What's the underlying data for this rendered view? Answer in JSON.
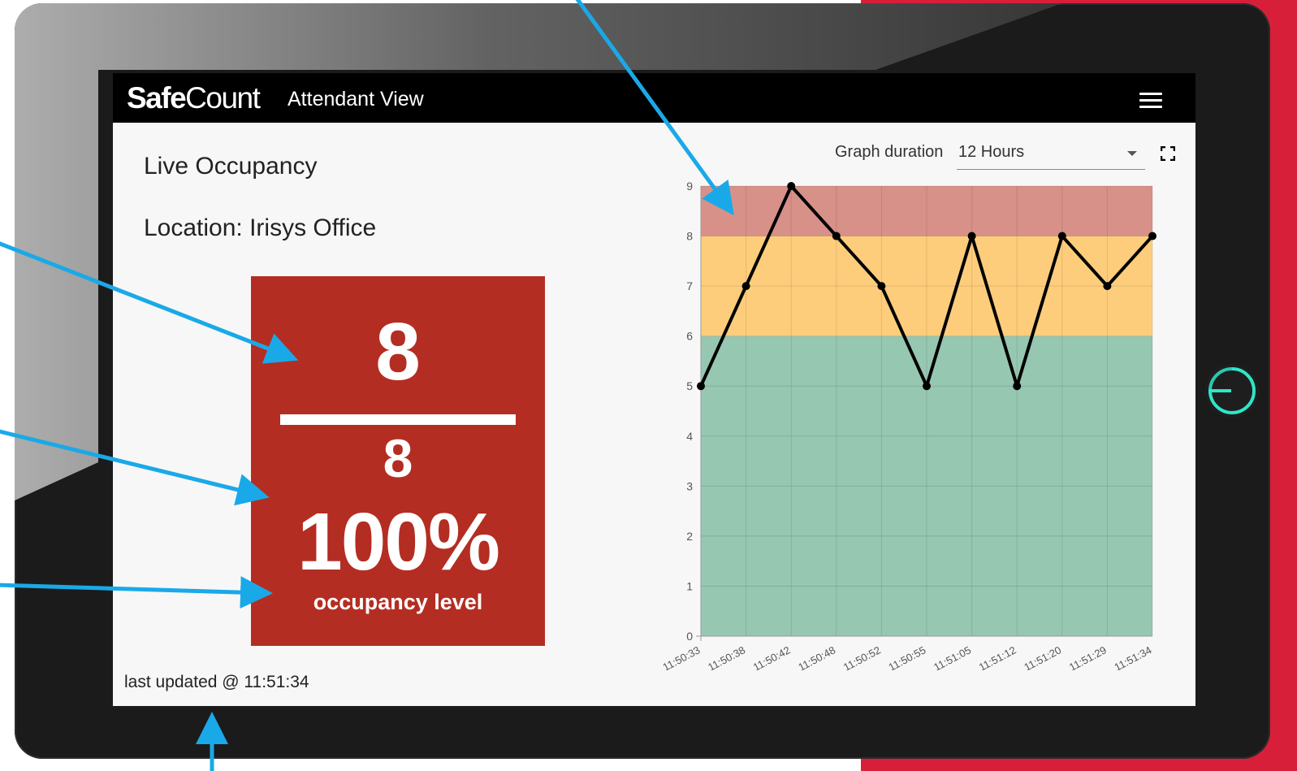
{
  "app": {
    "logo_bold": "Safe",
    "logo_regular": "Count",
    "view_title": "Attendant View"
  },
  "main": {
    "title": "Live Occupancy",
    "location": "Location: Irisys Office",
    "occupancy": {
      "current": "8",
      "capacity": "8",
      "percent": "100%",
      "label": "occupancy level",
      "status_color": "#b42d22"
    },
    "last_updated": "last updated @ 11:51:34"
  },
  "graph_controls": {
    "duration_label": "Graph duration",
    "duration_value": "12 Hours"
  },
  "icons": {
    "menu": "hamburger-menu-icon",
    "dropdown": "chevron-down-icon",
    "fullscreen": "fullscreen-icon",
    "power": "power-icon"
  },
  "chart_data": {
    "type": "line",
    "x": [
      "11:50:33",
      "11:50:38",
      "11:50:42",
      "11:50:48",
      "11:50:52",
      "11:50:55",
      "11:51:05",
      "11:51:12",
      "11:51:20",
      "11:51:29",
      "11:51:34"
    ],
    "series": [
      {
        "values": [
          5,
          7,
          9,
          8,
          7,
          5,
          8,
          5,
          8,
          7,
          8
        ],
        "color": "#000000"
      }
    ],
    "y_ticks": [
      0,
      1,
      2,
      3,
      4,
      5,
      6,
      7,
      8,
      9
    ],
    "ylim": [
      0,
      9
    ],
    "bands": [
      {
        "from": 0,
        "to": 6,
        "color": "#96c7b1"
      },
      {
        "from": 6,
        "to": 8,
        "color": "#fdcd7c"
      },
      {
        "from": 8,
        "to": 9,
        "color": "#d79189"
      }
    ],
    "grid": true
  }
}
